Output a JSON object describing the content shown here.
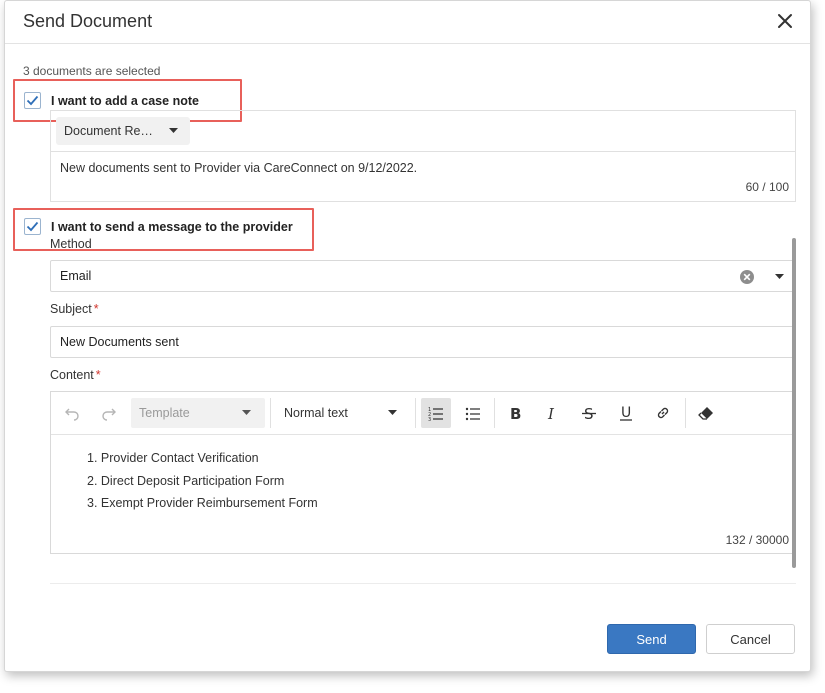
{
  "dialog": {
    "title": "Send Document",
    "selected_count": "3 documents are selected"
  },
  "case_note": {
    "checkbox_label": "I want to add a case note",
    "checked": true,
    "type_select": "Document Re…",
    "text": "New documents sent to Provider via CareConnect on 9/12/2022.",
    "counter": "60 / 100"
  },
  "message": {
    "checkbox_label": "I want to send a message to the provider",
    "checked": true,
    "method_label": "Method",
    "method_value": "Email",
    "subject_label": "Subject",
    "subject_value": "New Documents sent",
    "content_label": "Content",
    "required_mark": "*"
  },
  "editor": {
    "template_placeholder": "Template",
    "format_select": "Normal text",
    "items": [
      "1. Provider Contact Verification",
      "2. Direct Deposit Participation Form",
      "3. Exempt Provider Reimbursement Form"
    ],
    "counter": "132 / 30000",
    "toolbar_icons": [
      "undo-icon",
      "redo-icon",
      "ordered-list-icon",
      "bullet-list-icon",
      "bold-icon",
      "italic-icon",
      "strikethrough-icon",
      "underline-icon",
      "link-icon",
      "eraser-icon"
    ]
  },
  "footer": {
    "send_label": "Send",
    "cancel_label": "Cancel"
  },
  "colors": {
    "accent": "#3a78c2",
    "highlight": "#e8605a",
    "required": "#d0342c"
  }
}
